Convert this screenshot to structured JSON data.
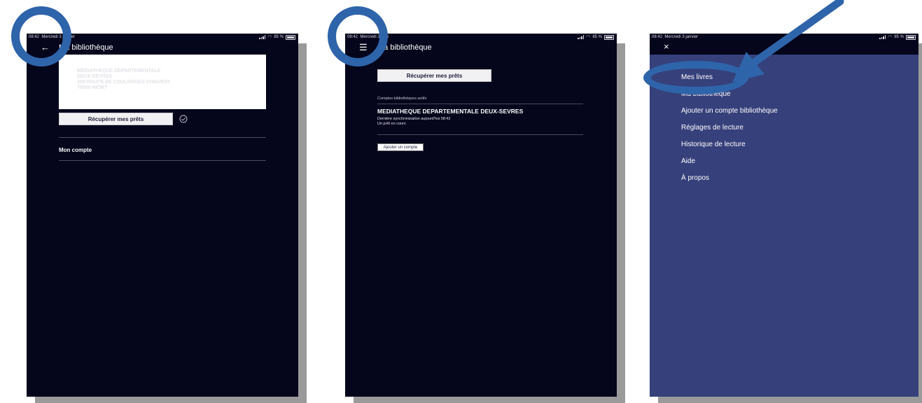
{
  "status": {
    "time": "08:42",
    "date": "Mercredi 3 janvier",
    "date_short": "Mercredi 3 janv",
    "battery": "85 %"
  },
  "screen1": {
    "title": "Ma bibliothèque",
    "address": "MEDIATHEQUE DEPARTEMENTALE\nDEUX-SEVRES\n209 ROUTE DE COULONGES CHAURAY\n79000 NIORT",
    "sync_button": "Récupérer mes prêts",
    "account_label": "Mon compte"
  },
  "screen2": {
    "title": "Ma bibliothèque",
    "sync_button": "Récupérer mes prêts",
    "section_label": "Comptes bibliothèques actifs",
    "library_name": "MEDIATHEQUE DEPARTEMENTALE DEUX-SEVRES",
    "last_sync": "Dernière synchronisation aujourd'hui 08:42",
    "loans": "Un prêt en cours",
    "add_account_button": "Ajouter un compte"
  },
  "screen3": {
    "menu": [
      "Mes livres",
      "Ma bibliothèque",
      "Ajouter un compte bibliothèque",
      "Réglages de lecture",
      "Historique de lecture",
      "Aide",
      "À propos"
    ]
  },
  "colors": {
    "screen_bg": "#05051c",
    "menu_bg": "#36407b",
    "annotation": "#2e64aa",
    "shadow": "#9a9a9a"
  }
}
